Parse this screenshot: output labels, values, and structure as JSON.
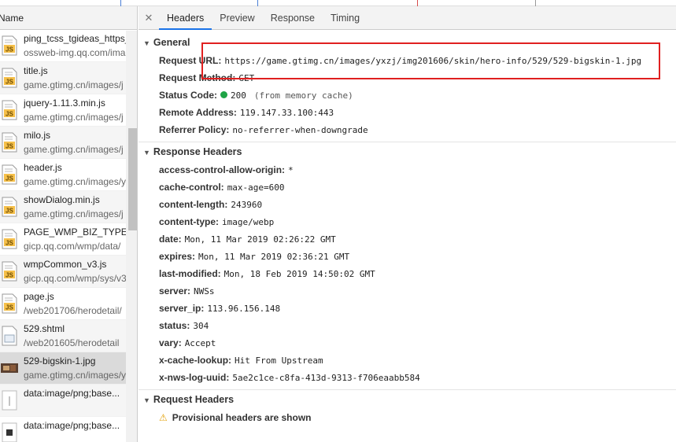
{
  "left": {
    "column_header": "Name",
    "rows": [
      {
        "name": "ping_tcss_tgideas_https_",
        "path": "ossweb-img.qq.com/ima",
        "icon": "js-file-icon"
      },
      {
        "name": "title.js",
        "path": "game.gtimg.cn/images/j",
        "icon": "js-file-icon"
      },
      {
        "name": "jquery-1.11.3.min.js",
        "path": "game.gtimg.cn/images/j",
        "icon": "js-file-icon"
      },
      {
        "name": "milo.js",
        "path": "game.gtimg.cn/images/j",
        "icon": "js-file-icon"
      },
      {
        "name": "header.js",
        "path": "game.gtimg.cn/images/y",
        "icon": "js-file-icon"
      },
      {
        "name": "showDialog.min.js",
        "path": "game.gtimg.cn/images/j",
        "icon": "js-file-icon"
      },
      {
        "name": "PAGE_WMP_BIZ_TYPE.js",
        "path": "gicp.qq.com/wmp/data/",
        "icon": "js-file-icon"
      },
      {
        "name": "wmpCommon_v3.js",
        "path": "gicp.qq.com/wmp/sys/v3",
        "icon": "js-file-icon"
      },
      {
        "name": "page.js",
        "path": "/web201706/herodetail/",
        "icon": "js-file-icon"
      },
      {
        "name": "529.shtml",
        "path": "/web201605/herodetail",
        "icon": "document-icon"
      },
      {
        "name": "529-bigskin-1.jpg",
        "path": "game.gtimg.cn/images/y",
        "icon": "image-thumbnail-icon"
      },
      {
        "name": "data:image/png;base...",
        "path": "",
        "icon": "data-image-icon"
      },
      {
        "name": "data:image/png;base...",
        "path": "",
        "icon": "data-image-dark-icon"
      }
    ]
  },
  "tabs": [
    "Headers",
    "Preview",
    "Response",
    "Timing"
  ],
  "general": {
    "title": "General",
    "items": [
      {
        "key": "Request URL:",
        "value": "https://game.gtimg.cn/images/yxzj/img201606/skin/hero-info/529/529-bigskin-1.jpg"
      },
      {
        "key": "Request Method:",
        "value": "GET"
      },
      {
        "key": "Status Code:",
        "value": "200",
        "extra": "(from memory cache)"
      },
      {
        "key": "Remote Address:",
        "value": "119.147.33.100:443"
      },
      {
        "key": "Referrer Policy:",
        "value": "no-referrer-when-downgrade"
      }
    ]
  },
  "response_headers": {
    "title": "Response Headers",
    "items": [
      {
        "key": "access-control-allow-origin:",
        "value": "*"
      },
      {
        "key": "cache-control:",
        "value": "max-age=600"
      },
      {
        "key": "content-length:",
        "value": "243960"
      },
      {
        "key": "content-type:",
        "value": "image/webp"
      },
      {
        "key": "date:",
        "value": "Mon, 11 Mar 2019 02:26:22 GMT"
      },
      {
        "key": "expires:",
        "value": "Mon, 11 Mar 2019 02:36:21 GMT"
      },
      {
        "key": "last-modified:",
        "value": "Mon, 18 Feb 2019 14:50:02 GMT"
      },
      {
        "key": "server:",
        "value": "NWSs"
      },
      {
        "key": "server_ip:",
        "value": "113.96.156.148"
      },
      {
        "key": "status:",
        "value": "304"
      },
      {
        "key": "vary:",
        "value": "Accept"
      },
      {
        "key": "x-cache-lookup:",
        "value": "Hit From Upstream"
      },
      {
        "key": "x-nws-log-uuid:",
        "value": "5ae2c1ce-c8fa-413d-9313-f706eaabb584"
      }
    ]
  },
  "request_headers": {
    "title": "Request Headers",
    "warning": "Provisional headers are shown"
  },
  "colors": {
    "highlight_box": "#e02020",
    "status_ok": "#1ea446",
    "active_tab": "#1a73e8"
  }
}
